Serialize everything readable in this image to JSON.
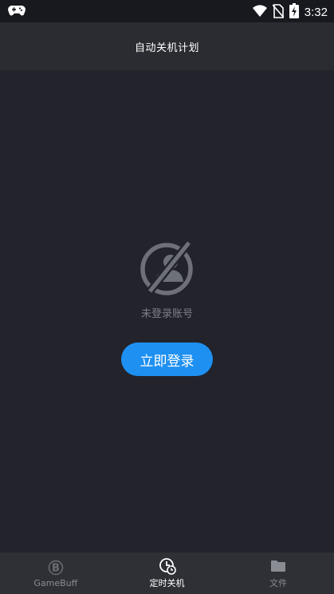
{
  "status_bar": {
    "time": "3:32"
  },
  "header": {
    "title": "自动关机计划"
  },
  "empty_state": {
    "icon": "no-account-icon",
    "message": "未登录账号",
    "login_button_label": "立即登录"
  },
  "bottom_nav": {
    "items": [
      {
        "label": "GameBuff",
        "icon": "gamebuff-icon",
        "active": false
      },
      {
        "label": "定时关机",
        "icon": "clock-timer-icon",
        "active": true
      },
      {
        "label": "文件",
        "icon": "folder-icon",
        "active": false
      }
    ]
  },
  "colors": {
    "background": "#22232b",
    "app_bar": "#2a2c31",
    "accent": "#1e90f2",
    "bottom_nav": "#2e3036"
  }
}
